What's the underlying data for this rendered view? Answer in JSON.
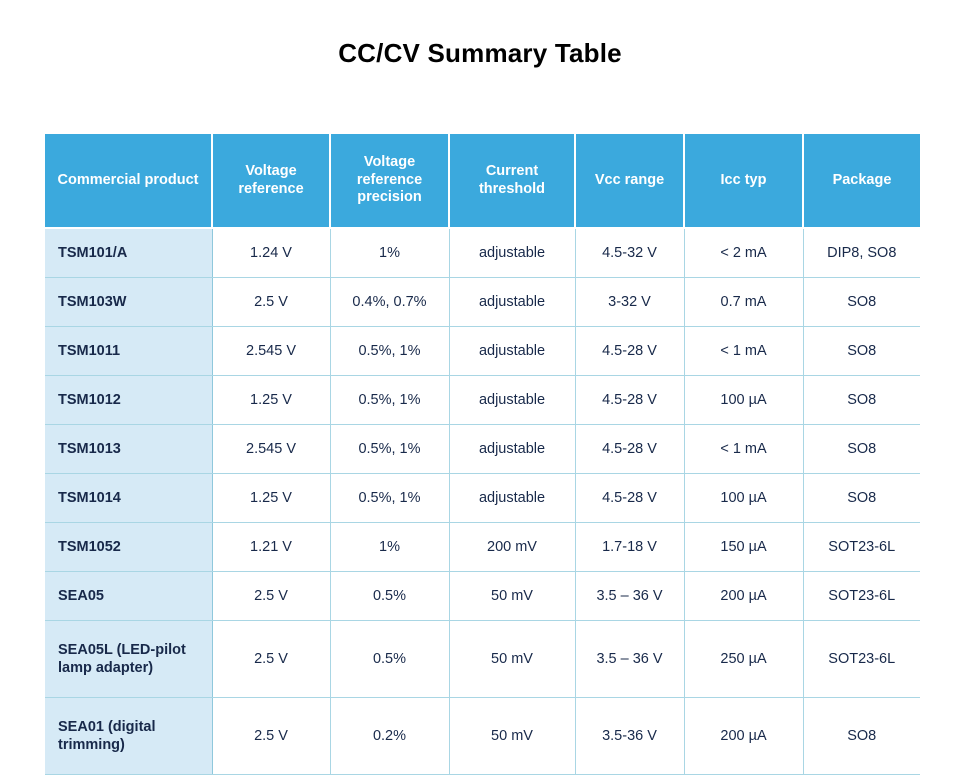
{
  "slide": {
    "title": "CC/CV Summary Table",
    "accent_color": "#3ba9dd",
    "product_column_tint": "#d6eaf6",
    "grid_line_color": "#a9d6e4",
    "text_color": "#18294a"
  },
  "table": {
    "headers": [
      "Commercial product",
      "Voltage reference",
      "Voltage reference precision",
      "Current threshold",
      "Vcc range",
      "Icc typ",
      "Package"
    ],
    "rows": [
      {
        "product": "TSM101/A",
        "voltage_reference": "1.24 V",
        "voltage_reference_precision": "1%",
        "current_threshold": "adjustable",
        "vcc_range": "4.5-32 V",
        "icc_typ": "< 2 mA",
        "package": "DIP8, SO8",
        "tall": false
      },
      {
        "product": "TSM103W",
        "voltage_reference": "2.5 V",
        "voltage_reference_precision": "0.4%, 0.7%",
        "current_threshold": "adjustable",
        "vcc_range": "3-32 V",
        "icc_typ": "0.7 mA",
        "package": "SO8",
        "tall": false
      },
      {
        "product": "TSM1011",
        "voltage_reference": "2.545 V",
        "voltage_reference_precision": "0.5%, 1%",
        "current_threshold": "adjustable",
        "vcc_range": "4.5-28 V",
        "icc_typ": "< 1 mA",
        "package": "SO8",
        "tall": false
      },
      {
        "product": "TSM1012",
        "voltage_reference": "1.25 V",
        "voltage_reference_precision": "0.5%, 1%",
        "current_threshold": "adjustable",
        "vcc_range": "4.5-28 V",
        "icc_typ": "100 µA",
        "package": "SO8",
        "tall": false
      },
      {
        "product": "TSM1013",
        "voltage_reference": "2.545 V",
        "voltage_reference_precision": "0.5%, 1%",
        "current_threshold": "adjustable",
        "vcc_range": "4.5-28 V",
        "icc_typ": "< 1 mA",
        "package": "SO8",
        "tall": false
      },
      {
        "product": "TSM1014",
        "voltage_reference": "1.25 V",
        "voltage_reference_precision": "0.5%, 1%",
        "current_threshold": "adjustable",
        "vcc_range": "4.5-28 V",
        "icc_typ": "100 µA",
        "package": "SO8",
        "tall": false
      },
      {
        "product": "TSM1052",
        "voltage_reference": "1.21 V",
        "voltage_reference_precision": "1%",
        "current_threshold": "200 mV",
        "vcc_range": "1.7-18 V",
        "icc_typ": "150 µA",
        "package": "SOT23-6L",
        "tall": false
      },
      {
        "product": "SEA05",
        "voltage_reference": "2.5 V",
        "voltage_reference_precision": "0.5%",
        "current_threshold": "50 mV",
        "vcc_range": "3.5 – 36 V",
        "icc_typ": "200 µA",
        "package": "SOT23-6L",
        "tall": false
      },
      {
        "product": "SEA05L (LED-pilot lamp adapter)",
        "voltage_reference": "2.5 V",
        "voltage_reference_precision": "0.5%",
        "current_threshold": "50 mV",
        "vcc_range": "3.5 – 36 V",
        "icc_typ": "250 µA",
        "package": "SOT23-6L",
        "tall": true
      },
      {
        "product": "SEA01 (digital trimming)",
        "voltage_reference": "2.5 V",
        "voltage_reference_precision": "0.2%",
        "current_threshold": "50 mV",
        "vcc_range": "3.5-36 V",
        "icc_typ": "200 µA",
        "package": "SO8",
        "tall": true
      }
    ]
  }
}
